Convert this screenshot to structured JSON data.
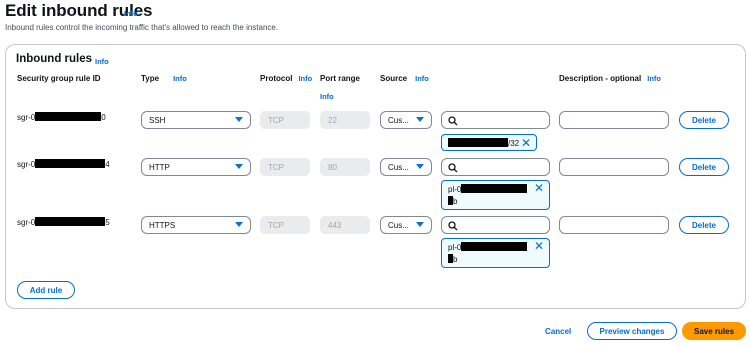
{
  "page": {
    "title": "Edit inbound rules",
    "info": "Info",
    "description": "Inbound rules control the incoming traffic that's allowed to reach the instance."
  },
  "panel": {
    "title": "Inbound rules",
    "info": "Info",
    "columns": {
      "rule_id": "Security group rule ID",
      "type": "Type",
      "protocol": "Protocol",
      "port_range": "Port range",
      "source": "Source",
      "description": "Description - optional",
      "info": "Info"
    }
  },
  "rules": [
    {
      "id_prefix": "sgr-0",
      "id_suffix": "0",
      "type": "SSH",
      "protocol": "TCP",
      "port": "22",
      "source": "Cus...",
      "search_value": "",
      "description_value": "",
      "token_line1_suffix": "/32",
      "token_line2_suffix": "",
      "delete": "Delete"
    },
    {
      "id_prefix": "sgr-0",
      "id_suffix": "4",
      "type": "HTTP",
      "protocol": "TCP",
      "port": "80",
      "source": "Cus...",
      "search_value": "",
      "description_value": "",
      "token_line1_prefix": "pl-0",
      "token_line2_suffix": "b",
      "delete": "Delete"
    },
    {
      "id_prefix": "sgr-0",
      "id_suffix": "5",
      "type": "HTTPS",
      "protocol": "TCP",
      "port": "443",
      "source": "Cus...",
      "search_value": "",
      "description_value": "",
      "token_line1_prefix": "pl-0",
      "token_line2_suffix": "b",
      "delete": "Delete"
    }
  ],
  "actions": {
    "add_rule": "Add rule",
    "cancel": "Cancel",
    "preview": "Preview changes",
    "save": "Save rules"
  },
  "colors": {
    "accent": "#006ce0",
    "primary_button": "#ff9900",
    "disabled_field": "#e9ebed"
  }
}
